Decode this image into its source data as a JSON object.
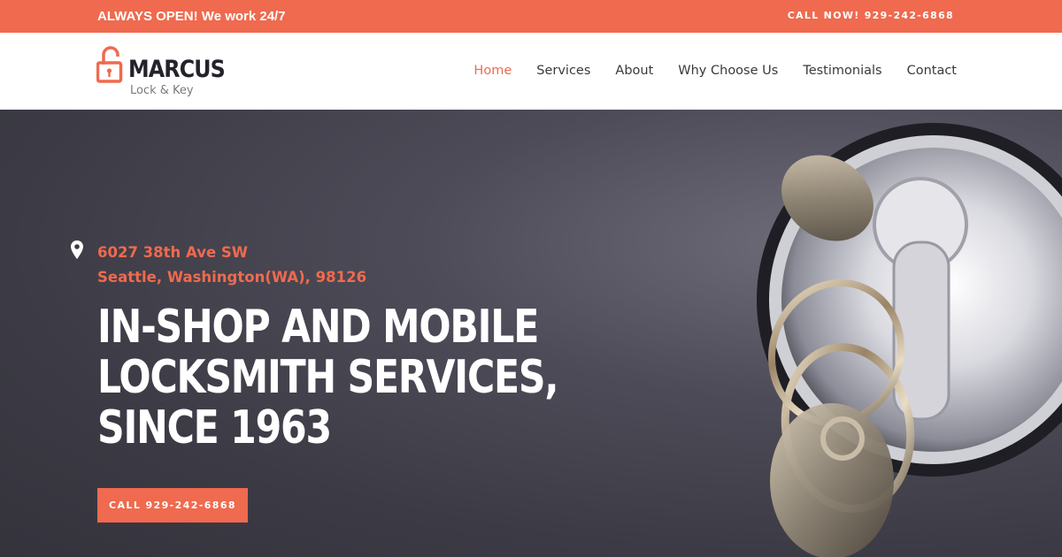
{
  "topbar": {
    "left_text": "ALWAYS OPEN! We work 24/7",
    "right_text": "CALL NOW! 929-242-6868"
  },
  "header": {
    "logo": {
      "brand": "MARCUS",
      "subtitle": "Lock & Key"
    },
    "nav": [
      {
        "label": "Home",
        "active": true
      },
      {
        "label": "Services"
      },
      {
        "label": "About"
      },
      {
        "label": "Why Choose Us"
      },
      {
        "label": "Testimonials"
      },
      {
        "label": "Contact"
      }
    ]
  },
  "hero": {
    "address_line1": "6027 38th Ave SW",
    "address_line2": "Seattle, Washington(WA), 98126",
    "headline": [
      "IN-SHOP AND MOBILE",
      "LOCKSMITH SERVICES,",
      "SINCE 1963"
    ],
    "cta_label": "CALL 929-242-6868"
  },
  "colors": {
    "accent": "#ef6a4e",
    "hero_bg": "#3c3b45",
    "text_dark": "#23232b"
  },
  "icons": [
    "padlock-icon",
    "location-pin-icon"
  ]
}
